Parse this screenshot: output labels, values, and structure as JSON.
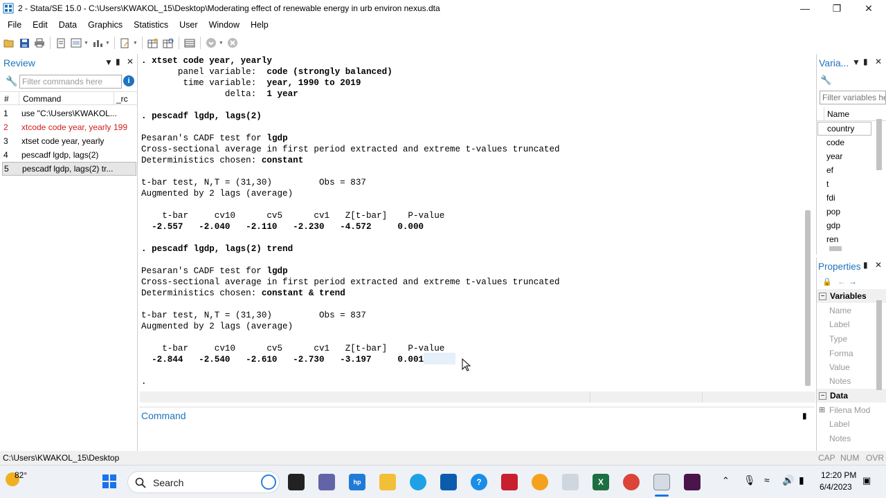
{
  "window": {
    "title": "2 - Stata/SE 15.0 - C:\\Users\\KWAKOL_15\\Desktop\\Moderating effect of renewable energy in urb environ nexus.dta"
  },
  "menu": [
    "File",
    "Edit",
    "Data",
    "Graphics",
    "Statistics",
    "User",
    "Window",
    "Help"
  ],
  "review": {
    "title": "Review",
    "filter_placeholder": "Filter commands here",
    "col_num": "#",
    "col_command": "Command",
    "col_rc": "_rc",
    "rows": [
      {
        "num": "1",
        "command": "use \"C:\\Users\\KWAKOL...",
        "rc": ""
      },
      {
        "num": "2",
        "command": "xtcode code year, yearly",
        "rc": "199"
      },
      {
        "num": "3",
        "command": "xtset code year, yearly",
        "rc": ""
      },
      {
        "num": "4",
        "command": "pescadf lgdp, lags(2)",
        "rc": ""
      },
      {
        "num": "5",
        "command": "pescadf lgdp, lags(2) tr...",
        "rc": ""
      }
    ],
    "error_color": "#d11d1d"
  },
  "results": {
    "lines": [
      ". xtset code year, yearly",
      "       panel variable:  code (strongly balanced)",
      "        time variable:  year, 1990 to 2019",
      "                delta:  1 year",
      "",
      ". pescadf lgdp, lags(2)",
      "",
      "Pesaran's CADF test for lgdp",
      "Cross-sectional average in first period extracted and extreme t-values truncated",
      "Deterministics chosen: constant",
      "",
      "t-bar test, N,T = (31,30)         Obs = 837",
      "Augmented by 2 lags (average)",
      "",
      "    t-bar     cv10      cv5      cv1   Z[t-bar]    P-value",
      "  -2.557   -2.040   -2.110   -2.230   -4.572     0.000",
      "",
      ". pescadf lgdp, lags(2) trend",
      "",
      "Pesaran's CADF test for lgdp",
      "Cross-sectional average in first period extracted and extreme t-values truncated",
      "Deterministics chosen: constant & trend",
      "",
      "t-bar test, N,T = (31,30)         Obs = 837",
      "Augmented by 2 lags (average)",
      "",
      "    t-bar     cv10      cv5      cv1   Z[t-bar]    P-value",
      "  -2.844   -2.540   -2.610   -2.730   -3.197     0.001",
      "",
      "."
    ]
  },
  "command": {
    "label": "Command"
  },
  "variables": {
    "title": "Varia...",
    "filter_placeholder": "Filter variables he",
    "col_name": "Name",
    "items": [
      "country",
      "code",
      "year",
      "ef",
      "t",
      "fdi",
      "pop",
      "gdp",
      "ren"
    ]
  },
  "properties": {
    "title": "Properties",
    "section_variables": "Variables",
    "var_fields": [
      "Name",
      "Label",
      "Type",
      "Forma",
      "Value",
      "Notes"
    ],
    "section_data": "Data",
    "data_fields": [
      "Filena",
      "Label",
      "Notes"
    ],
    "filename_value": "Mod"
  },
  "status": {
    "path": "C:\\Users\\KWAKOL_15\\Desktop",
    "caps": "CAP",
    "num": "NUM",
    "ovr": "OVR"
  },
  "taskbar": {
    "weather": "82°",
    "search": "Search",
    "time": "12:20 PM",
    "date": "6/4/2023"
  },
  "colors": {
    "accent": "#1e73be",
    "selection": "#cfe3f7"
  }
}
